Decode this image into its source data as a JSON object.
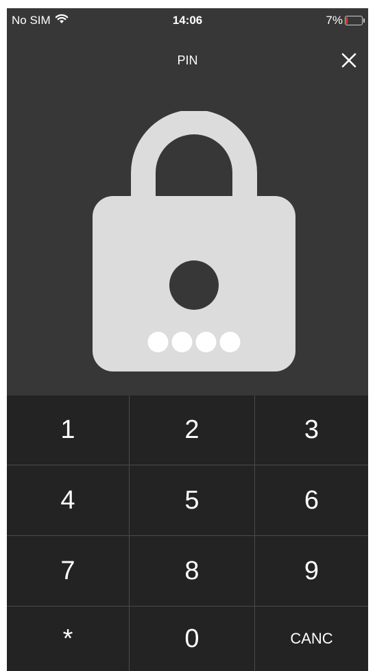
{
  "status_bar": {
    "carrier": "No SIM",
    "time": "14:06",
    "battery": "7%",
    "battery_level": 0.07,
    "icons": [
      "wifi-icon",
      "battery-icon"
    ]
  },
  "header": {
    "title": "PIN",
    "close_icon": "close-icon"
  },
  "lock": {
    "icon": "padlock-icon",
    "pin_length": 4,
    "entered_digits": 4
  },
  "keypad": {
    "keys": [
      {
        "label": "1"
      },
      {
        "label": "2"
      },
      {
        "label": "3"
      },
      {
        "label": "4"
      },
      {
        "label": "5"
      },
      {
        "label": "6"
      },
      {
        "label": "7"
      },
      {
        "label": "8"
      },
      {
        "label": "9"
      },
      {
        "label": "*"
      },
      {
        "label": "0"
      },
      {
        "label": "CANC"
      }
    ]
  },
  "colors": {
    "background": "#373737",
    "keypad_background": "#232323",
    "lock": "#dcdcdc",
    "text": "#ffffff"
  }
}
